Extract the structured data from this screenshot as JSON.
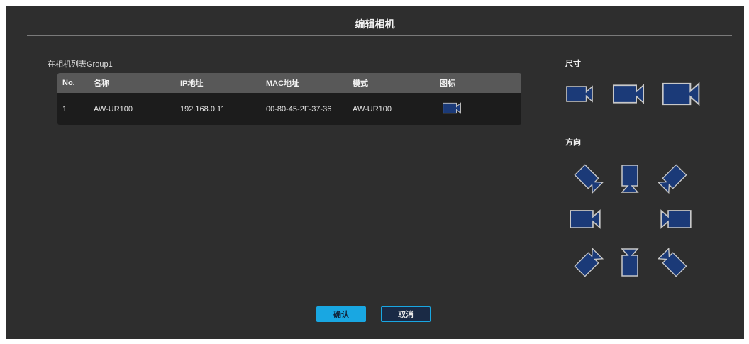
{
  "dialog": {
    "title": "编辑相机",
    "list_caption": "在相机列表Group1",
    "table": {
      "columns": [
        "No.",
        "名称",
        "IP地址",
        "MAC地址",
        "模式",
        "图标"
      ],
      "rows": [
        {
          "no": "1",
          "name": "AW-UR100",
          "ip": "192.168.0.11",
          "mac": "00-80-45-2F-37-36",
          "model": "AW-UR100",
          "icon": "camera-icon"
        }
      ]
    },
    "size_label": "尺寸",
    "direction_label": "方向",
    "confirm_label": "确认",
    "cancel_label": "取消"
  },
  "colors": {
    "icon_fill": "#1b3a78",
    "icon_stroke": "#c8c8c8",
    "accent": "#19a7e2"
  },
  "icons": {
    "size_options": [
      "camera-small-icon",
      "camera-medium-icon",
      "camera-large-icon"
    ],
    "direction_options": [
      "camera-up-left-icon",
      "camera-up-icon",
      "camera-up-right-icon",
      "camera-left-icon",
      "camera-right-icon",
      "camera-down-left-icon",
      "camera-down-icon",
      "camera-down-right-icon"
    ]
  }
}
